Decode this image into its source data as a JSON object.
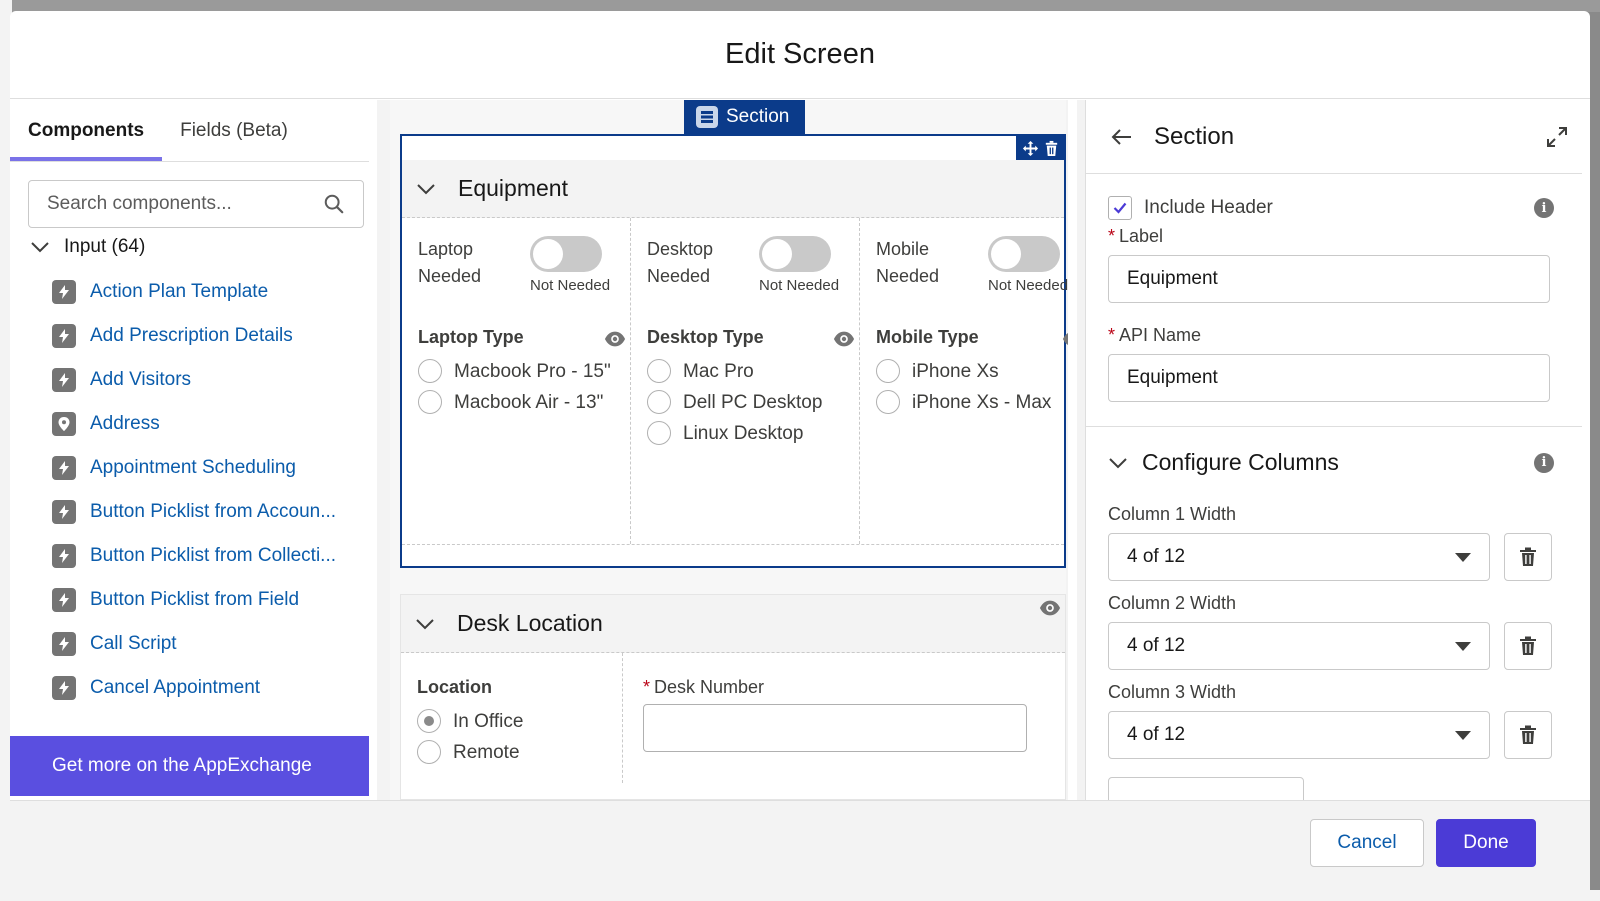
{
  "modal": {
    "title": "Edit Screen"
  },
  "left_panel": {
    "tabs": [
      {
        "label": "Components",
        "active": true
      },
      {
        "label": "Fields (Beta)",
        "active": false
      }
    ],
    "search": {
      "placeholder": "Search components...",
      "value": ""
    },
    "group": {
      "label": "Input (64)",
      "expanded": true
    },
    "components": [
      {
        "label": "Action Plan Template",
        "icon": "bolt-icon"
      },
      {
        "label": "Add Prescription Details",
        "icon": "bolt-icon"
      },
      {
        "label": "Add Visitors",
        "icon": "bolt-icon"
      },
      {
        "label": "Address",
        "icon": "location-pin-icon"
      },
      {
        "label": "Appointment Scheduling",
        "icon": "bolt-icon"
      },
      {
        "label": "Button Picklist from Accoun...",
        "icon": "bolt-icon"
      },
      {
        "label": "Button Picklist from Collecti...",
        "icon": "bolt-icon"
      },
      {
        "label": "Button Picklist from Field",
        "icon": "bolt-icon"
      },
      {
        "label": "Call Script",
        "icon": "bolt-icon"
      },
      {
        "label": "Cancel Appointment",
        "icon": "bolt-icon"
      }
    ],
    "appexchange_label": "Get more on the AppExchange"
  },
  "canvas": {
    "section_tag": "Section",
    "section1": {
      "title": "Equipment",
      "columns": [
        {
          "toggle_label": "Laptop Needed",
          "toggle_state": "Not Needed",
          "field_label": "Laptop Type",
          "options": [
            "Macbook Pro - 15\"",
            "Macbook Air - 13\""
          ]
        },
        {
          "toggle_label": "Desktop Needed",
          "toggle_state": "Not Needed",
          "field_label": "Desktop Type",
          "options": [
            "Mac Pro",
            "Dell PC Desktop",
            "Linux Desktop"
          ]
        },
        {
          "toggle_label": "Mobile Needed",
          "toggle_state": "Not Needed",
          "field_label": "Mobile Type",
          "options": [
            "iPhone Xs",
            "iPhone Xs - Max"
          ]
        }
      ]
    },
    "section2": {
      "title": "Desk Location",
      "location": {
        "label": "Location",
        "options": [
          {
            "label": "In Office",
            "checked": true
          },
          {
            "label": "Remote",
            "checked": false
          }
        ]
      },
      "desk_number": {
        "label": "Desk Number",
        "required": true,
        "value": ""
      }
    }
  },
  "properties": {
    "title": "Section",
    "include_header": {
      "label": "Include Header",
      "checked": true
    },
    "label_field": {
      "label": "Label",
      "value": "Equipment",
      "required": true
    },
    "api_name_field": {
      "label": "API Name",
      "value": "Equipment",
      "required": true
    },
    "configure_columns": {
      "title": "Configure Columns",
      "columns": [
        {
          "label": "Column 1 Width",
          "value": "4 of 12"
        },
        {
          "label": "Column 2 Width",
          "value": "4 of 12"
        },
        {
          "label": "Column 3 Width",
          "value": "4 of 12"
        }
      ]
    }
  },
  "footer": {
    "cancel_label": "Cancel",
    "done_label": "Done"
  },
  "colors": {
    "brand": "#5a4fe0",
    "primary_button": "#4b3bd6",
    "link": "#0b5cab",
    "selection": "#0b3b8a"
  }
}
